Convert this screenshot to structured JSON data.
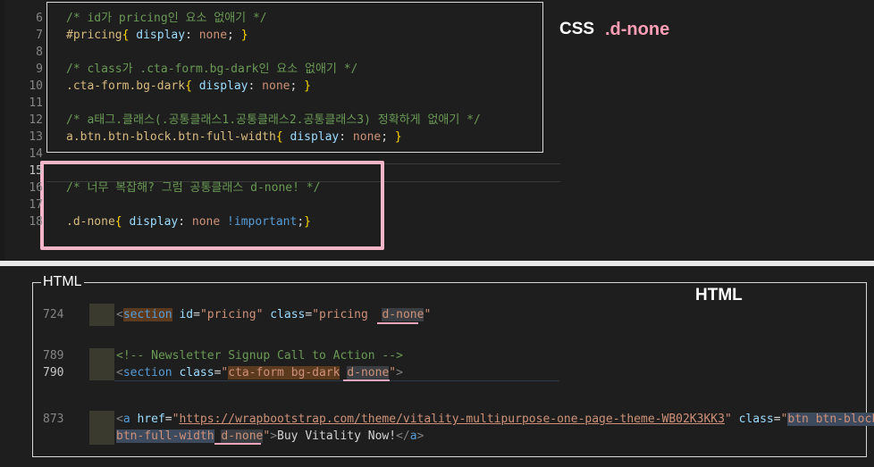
{
  "labels": {
    "css": "CSS",
    "dnone": ".d-none",
    "html_left": "HTML",
    "html_right": "HTML"
  },
  "css_lines": [
    {
      "n": "6",
      "comment": "/* id가 pricing인 요소 없애기 */"
    },
    {
      "n": "7",
      "sel": "#pricing",
      "brace_open": "{",
      "prop": "display",
      "colon": ":",
      "val": "none",
      "semi": ";",
      "brace_close": "}"
    },
    {
      "n": "8"
    },
    {
      "n": "9",
      "comment": "/* class가 .cta-form.bg-dark인 요소 없애기 */"
    },
    {
      "n": "10",
      "sel": ".cta-form.bg-dark",
      "brace_open": "{",
      "prop": "display",
      "colon": ":",
      "val": "none",
      "semi": ";",
      "brace_close": "}"
    },
    {
      "n": "11"
    },
    {
      "n": "12",
      "comment": "/* a태그.클래스(.공통클래스1.공통클래스2.공통클래스3) 정확하게 없애기 */"
    },
    {
      "n": "13",
      "sel": "a.btn.btn-block.btn-full-width",
      "brace_open": "{",
      "prop": "display",
      "colon": ":",
      "val": "none",
      "semi": ";",
      "brace_close": "}"
    },
    {
      "n": "14"
    },
    {
      "n": "15"
    },
    {
      "n": "16",
      "comment": "/* 너무 복잡해? 그럼 공통클래스 d-none! */"
    },
    {
      "n": "17"
    },
    {
      "n": "18",
      "sel": ".d-none",
      "brace_open": "{",
      "prop": "display",
      "colon": ":",
      "val": "none",
      "imp": "!important",
      "semi": ";",
      "brace_close": "}"
    }
  ],
  "html_lines": {
    "l724": {
      "n": "724",
      "lt": "<",
      "tag": "section",
      "a1": "id",
      "eq": "=",
      "q": "\"",
      "v1": "pricing",
      "a2": "class",
      "v2a": "pricing",
      "v2b": "d-none"
    },
    "l789": {
      "n": "789",
      "comment": "<!-- Newsletter Signup Call to Action -->"
    },
    "l790": {
      "n": "790",
      "lt": "<",
      "tag": "section",
      "a1": "class",
      "eq": "=",
      "q": "\"",
      "v1a": "cta-form bg-dark",
      "v1b": "d-none",
      "gt": ">"
    },
    "l873": {
      "n": "873",
      "lt": "<",
      "tag": "a",
      "a1": "href",
      "eq": "=",
      "q": "\"",
      "v1": "https://wrapbootstrap.com/theme/vitality-multipurpose-one-page-theme-WB02K3KK3",
      "a2": "class",
      "v2a": "btn btn-block",
      "v2b": "btn-full-width",
      "v2c": "d-none",
      "gt": ">",
      "text": "Buy Vitality Now!",
      "close": "</",
      "gt2": ">"
    }
  }
}
